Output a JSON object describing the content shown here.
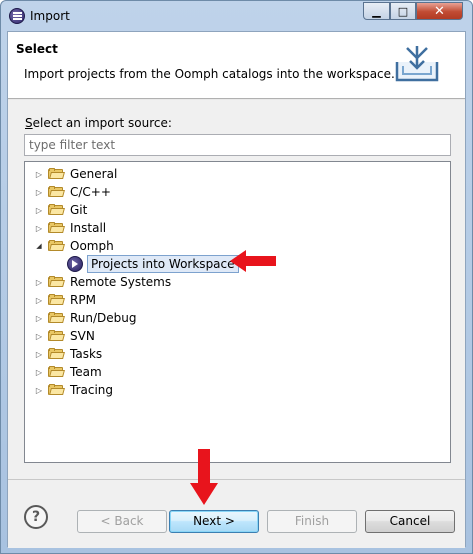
{
  "window": {
    "title": "Import",
    "minimize_glyph": "▁",
    "maximize_glyph": "□",
    "close_glyph": "✕"
  },
  "header": {
    "title": "Select",
    "description": "Import projects from the Oomph catalogs into the workspace."
  },
  "source": {
    "label_prefix": "S",
    "label_rest": "elect an import source:",
    "filter_placeholder": "type filter text",
    "filter_value": ""
  },
  "tree": {
    "items": [
      {
        "label": "General",
        "expanded": false
      },
      {
        "label": "C/C++",
        "expanded": false
      },
      {
        "label": "Git",
        "expanded": false
      },
      {
        "label": "Install",
        "expanded": false
      },
      {
        "label": "Oomph",
        "expanded": true
      },
      {
        "label": "Remote Systems",
        "expanded": false
      },
      {
        "label": "RPM",
        "expanded": false
      },
      {
        "label": "Run/Debug",
        "expanded": false
      },
      {
        "label": "SVN",
        "expanded": false
      },
      {
        "label": "Tasks",
        "expanded": false
      },
      {
        "label": "Team",
        "expanded": false
      },
      {
        "label": "Tracing",
        "expanded": false
      }
    ],
    "selected_child": {
      "parent": "Oomph",
      "label": "Projects into Workspace"
    },
    "collapsed_glyph": "▷",
    "expanded_glyph": "◢"
  },
  "buttons": {
    "help": "?",
    "back": "< Back",
    "next": "Next >",
    "finish": "Finish",
    "cancel": "Cancel"
  },
  "colors": {
    "annotation_arrow": "#e8141c",
    "title_bar": "#bfd3ea"
  }
}
